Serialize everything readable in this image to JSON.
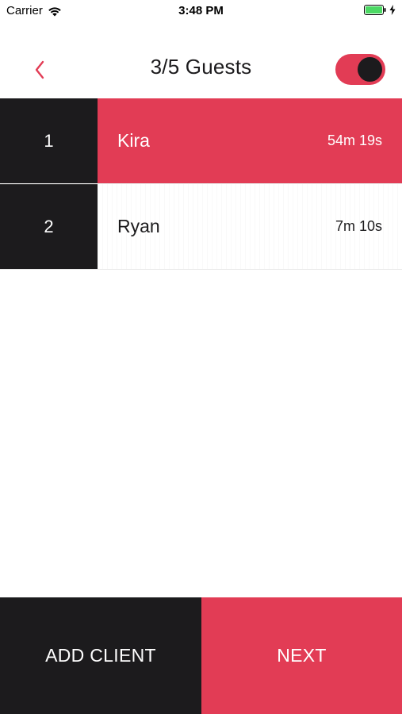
{
  "status_bar": {
    "carrier": "Carrier",
    "time": "3:48 PM",
    "icons": [
      "wifi-icon",
      "battery-icon",
      "charging-bolt-icon"
    ]
  },
  "header": {
    "title": "3/5 Guests",
    "back_icon": "chevron-left-icon",
    "toggle_on": true
  },
  "guests": [
    {
      "index": "1",
      "name": "Kira",
      "time": "54m 19s",
      "active": true
    },
    {
      "index": "2",
      "name": "Ryan",
      "time": "7m 10s",
      "active": false
    }
  ],
  "actions": {
    "add_client_label": "ADD CLIENT",
    "next_label": "NEXT"
  },
  "colors": {
    "accent": "#e23c55",
    "dark": "#1c1b1d",
    "battery": "#4cd964"
  }
}
